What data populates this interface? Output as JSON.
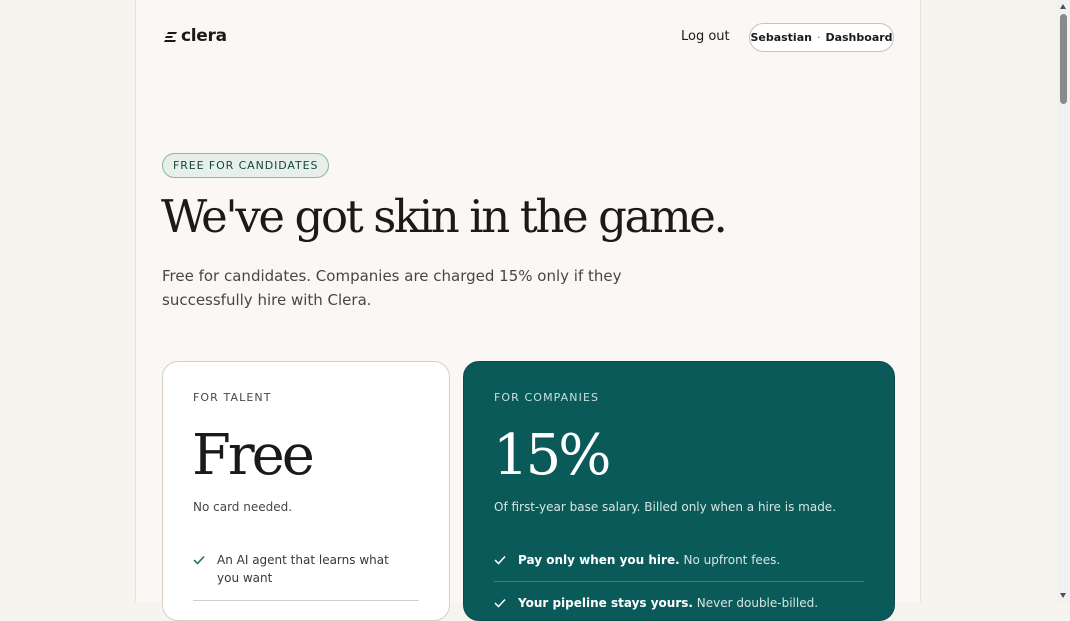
{
  "header": {
    "brand": "clera",
    "logout_label": "Log out",
    "user_name": "Sebastian",
    "separator": "·",
    "dashboard_label": "Dashboard"
  },
  "hero": {
    "badge": "FREE FOR CANDIDATES",
    "headline": "We've got skin in the game.",
    "subtitle": "Free for candidates. Companies are charged 15% only if they successfully hire with Clera."
  },
  "talent_card": {
    "eyebrow": "FOR TALENT",
    "price": "Free",
    "note": "No card needed.",
    "features": [
      "An AI agent that learns what you want"
    ]
  },
  "companies_card": {
    "eyebrow": "FOR COMPANIES",
    "price": "15%",
    "note": "Of first-year base salary. Billed only when a hire is made.",
    "features": [
      {
        "strong": "Pay only when you hire.",
        "text": " No upfront fees."
      },
      {
        "strong": "Your pipeline stays yours.",
        "text": " Never double-billed."
      }
    ]
  },
  "colors": {
    "background": "#faf7f4",
    "accent_teal": "#0b5a5a",
    "badge_green": "#e6efe9"
  },
  "icons": [
    "clera-logo-icon",
    "check-icon"
  ]
}
